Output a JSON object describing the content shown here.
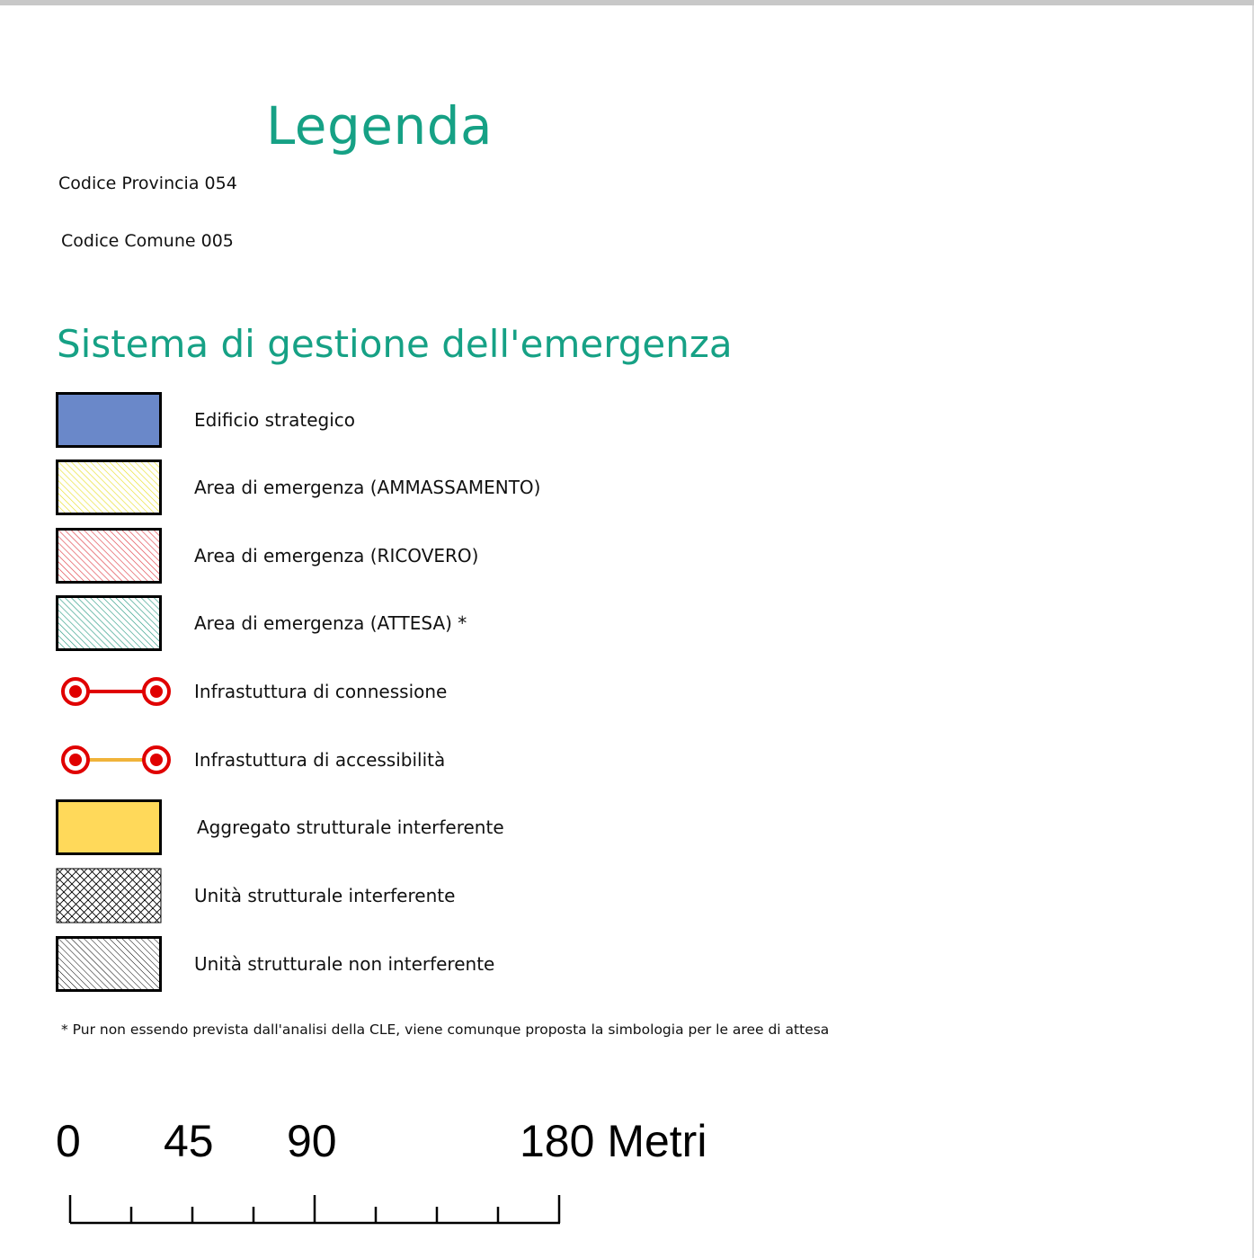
{
  "title": "Legenda",
  "codes": {
    "provincia": "Codice Provincia 054",
    "comune": "Codice Comune 005"
  },
  "section_title": "Sistema di gestione dell'emergenza",
  "colors": {
    "accent": "#16a185",
    "edificio": "#6a88c9",
    "ammassamento": "#e9e02c",
    "ricovero": "#e0414a",
    "attesa": "#2f9e86",
    "connessione": "#e00000",
    "accessibilita": "#f0b33a",
    "aggregato": "#ffd95a"
  },
  "legend": [
    {
      "id": "edificio",
      "symbol": "fill-blue",
      "label": "Edificio strategico"
    },
    {
      "id": "ammassamento",
      "symbol": "hatch-yellow",
      "label": "Area di emergenza (AMMASSAMENTO)"
    },
    {
      "id": "ricovero",
      "symbol": "hatch-red",
      "label": "Area di emergenza (RICOVERO)"
    },
    {
      "id": "attesa",
      "symbol": "hatch-green",
      "label": "Area di emergenza (ATTESA) *"
    },
    {
      "id": "connessione",
      "symbol": "line-red-nodes",
      "label": "Infrastuttura di connessione"
    },
    {
      "id": "accessibilita",
      "symbol": "line-orange-nodes",
      "label": "Infrastuttura di accessibilità"
    },
    {
      "id": "aggregato",
      "symbol": "fill-yellow",
      "label": "Aggregato strutturale interferente"
    },
    {
      "id": "unita-interferente",
      "symbol": "crosshatch-black",
      "label": "Unità strutturale interferente"
    },
    {
      "id": "unita-non-interferente",
      "symbol": "hatch-black",
      "label": "Unità strutturale non interferente"
    }
  ],
  "note": "* Pur non essendo prevista dall'analisi della CLE, viene comunque proposta la simbologia per le aree di attesa",
  "scale": {
    "labels": [
      "0",
      "45",
      "90",
      "180 Metri"
    ],
    "unit": "Metri"
  }
}
